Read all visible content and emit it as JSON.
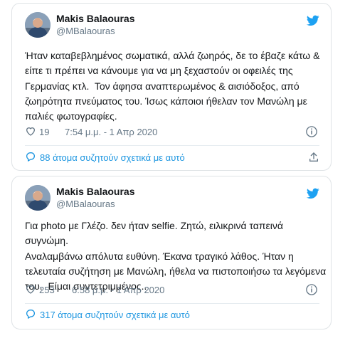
{
  "colors": {
    "link": "#1b95e0",
    "muted": "#657786",
    "text": "#14171a",
    "border": "#dfe3e6"
  },
  "tweets": [
    {
      "user": {
        "name": "Makis Balaouras",
        "handle": "@MBalaouras"
      },
      "text": "Ήταν καταβεβλημένος σωματικά, αλλά ζωηρός, δε το έβαζε κάτω &\nείπε τι πρέπει να κάνουμε για να μη ξεχαστούν οι οφειλές της\nΓερμανίας κτλ.  Τον άφησα αναπτερωμένος & αισιόδοξος, από\nζωηρότητα πνεύματος του. Ίσως κάποιοι ήθελαν τον Μανώλη με\nπαλιές φωτογραφίες.",
      "likes": "19",
      "timestamp": "7:54 μ.μ. - 1 Απρ 2020",
      "conversation": "88 άτομα συζητούν σχετικά με αυτό",
      "icons": [
        "avatar",
        "twitter-bird-icon",
        "heart-icon",
        "info-icon",
        "reply-bubble-icon",
        "share-icon"
      ]
    },
    {
      "user": {
        "name": "Makis Balaouras",
        "handle": "@MBalaouras"
      },
      "text": "Για photo με Γλέζο. δεν ήταν selfie. Ζητώ, ειλικρινά ταπεινά συγνώμη.\nΑναλαμβάνω απόλυτα ευθύνη. Έκανα τραγικό λάθος. Ήταν η\nτελευταία συζήτηση με Μανώλη, ήθελα να πιστοποιήσω τα λεγόμενα\nτου.  Είμαι συντετριμμένος..",
      "likes": "253",
      "timestamp": "6:58 μ.μ. - 1 Απρ 2020",
      "conversation": "317 άτομα συζητούν σχετικά με αυτό",
      "icons": [
        "avatar",
        "twitter-bird-icon",
        "heart-icon",
        "info-icon",
        "reply-bubble-icon",
        "share-icon"
      ]
    }
  ]
}
